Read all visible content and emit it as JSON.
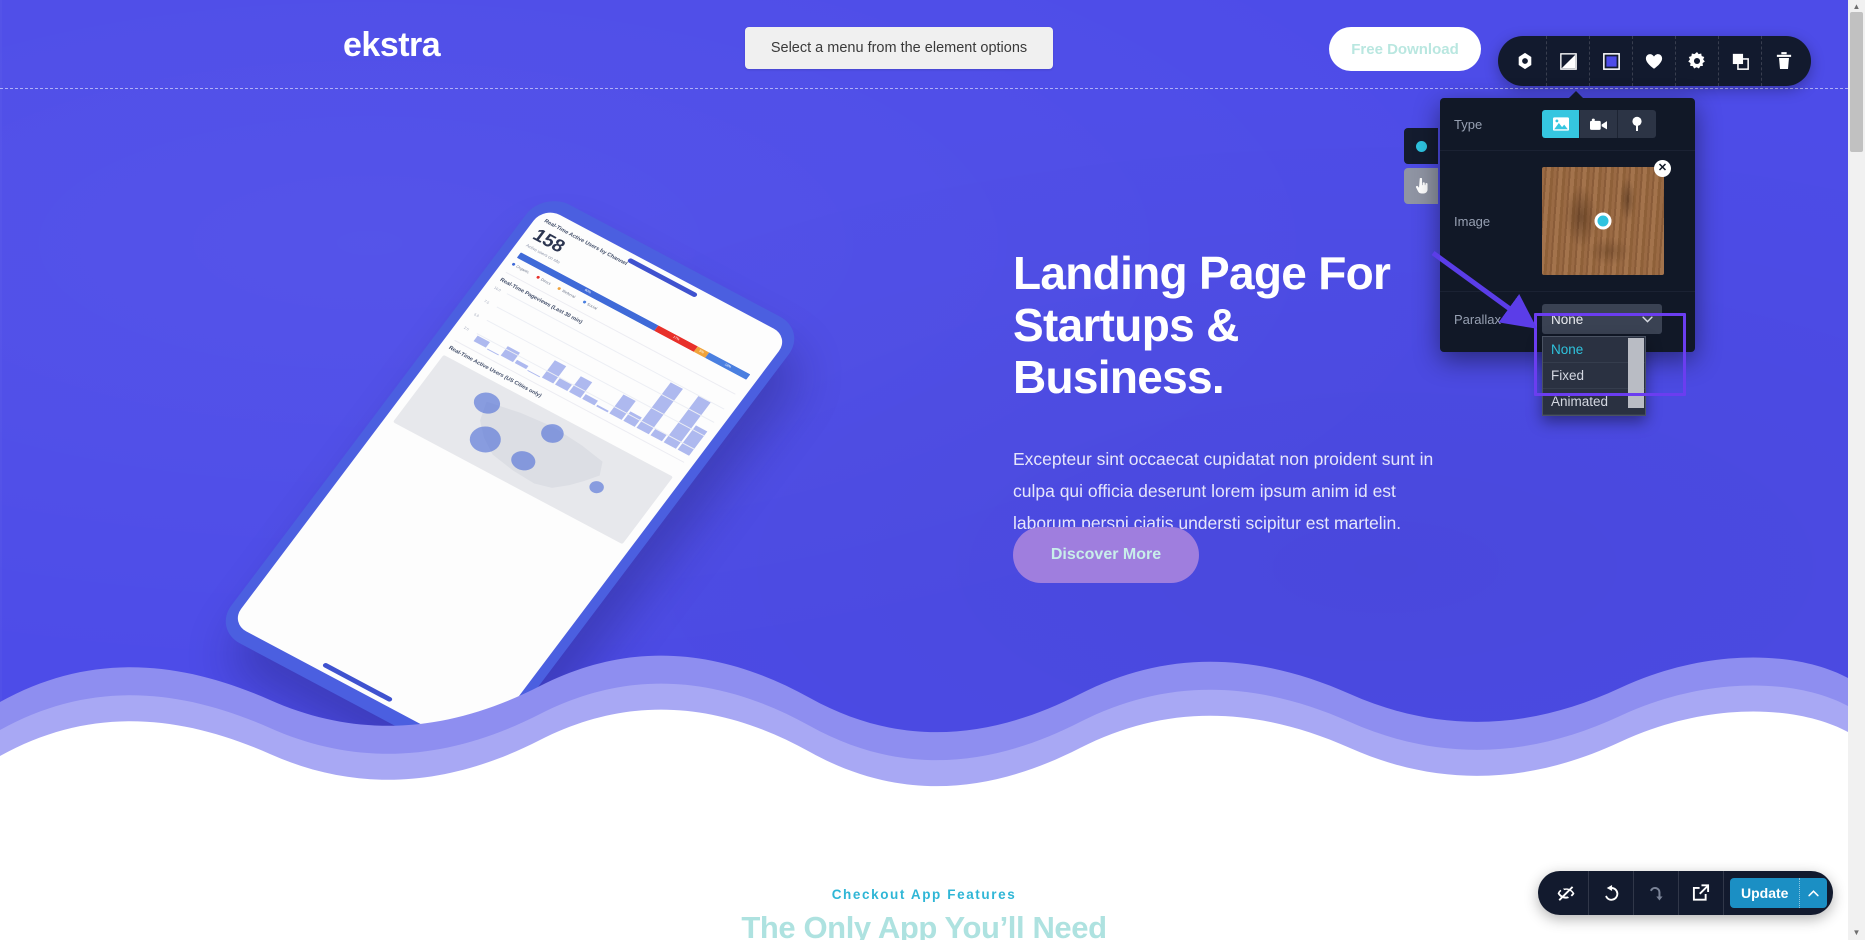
{
  "site": {
    "brand": "ekstra",
    "menu_placeholder": "Select a menu from the element options",
    "free_download_label": "Free Download",
    "hero_title": "Landing Page For\nStartups & Business.",
    "hero_paragraph": "Excepteur sint occaecat cupidatat non proident sunt in culpa qui officia deserunt lorem ipsum anim id est laborum perspi ciatis understi scipitur est martelin.",
    "discover_label": "Discover More",
    "lower_eyebrow": "Checkout App Features",
    "lower_title": "The Only App You’ll Need",
    "bg_color": "#4d4ce8",
    "accent_purple": "#9f7ede",
    "accent_mint": "#aee2e0",
    "accent_cyan": "#2fb6d6"
  },
  "phone_mockup": {
    "card1_title": "Real-Time Active Users by Channel",
    "active_users_count": "158",
    "active_users_note": "Active users on site",
    "stacked_bar": [
      {
        "label": "60%",
        "color": "#3f6ad8"
      },
      {
        "label": "17%",
        "color": "#e8302a"
      },
      {
        "label": "5%",
        "color": "#f0a33c"
      },
      {
        "label": "18%",
        "color": "#4a7fe0"
      }
    ],
    "legend": [
      {
        "label": "Organic",
        "color": "#3f6ad8"
      },
      {
        "label": "Direct",
        "color": "#e8302a"
      },
      {
        "label": "Referral",
        "color": "#f0a33c"
      },
      {
        "label": "Social",
        "color": "#4a7fe0"
      }
    ],
    "card2_title": "Real-Time Pageviews (Last 30 min)",
    "y_ticks": [
      "10.0",
      "7.5",
      "5.0",
      "2.5"
    ],
    "bar_values": [
      1.2,
      0,
      2.0,
      0.6,
      0,
      3.6,
      1.4,
      3.4,
      1.0,
      0.4,
      4.0,
      2.0,
      9.6,
      1.4,
      9.8,
      5.2
    ],
    "card3_title": "Real-Time Active Users (US Cities only)"
  },
  "element_toolbar": {
    "items": [
      {
        "name": "shape-icon",
        "tooltip": "Shape"
      },
      {
        "name": "corner-icon",
        "tooltip": "Corner"
      },
      {
        "name": "background-icon",
        "tooltip": "Background",
        "active": true
      },
      {
        "name": "heart-icon",
        "tooltip": "Favorite"
      },
      {
        "name": "gear-icon",
        "tooltip": "Settings"
      },
      {
        "name": "duplicate-icon",
        "tooltip": "Duplicate"
      },
      {
        "name": "trash-icon",
        "tooltip": "Delete"
      }
    ]
  },
  "background_popover": {
    "type_label": "Type",
    "type_options": [
      {
        "name": "image-type",
        "active": true
      },
      {
        "name": "video-type",
        "active": false
      },
      {
        "name": "color-type",
        "active": false
      }
    ],
    "image_label": "Image",
    "image_close": "✕",
    "parallax_label": "Parallax",
    "parallax_value": "None",
    "parallax_options": [
      "None",
      "Fixed",
      "Animated"
    ],
    "parallax_selected": "None",
    "highlight_color": "#6b3df0"
  },
  "bottom_toolbar": {
    "items": [
      {
        "name": "hide-icon",
        "tooltip": "Hide"
      },
      {
        "name": "undo-icon",
        "tooltip": "Undo"
      },
      {
        "name": "redo-icon",
        "tooltip": "Redo",
        "disabled": true
      },
      {
        "name": "preview-icon",
        "tooltip": "Preview"
      }
    ],
    "update_label": "Update",
    "update_color": "#1b8fc4"
  }
}
